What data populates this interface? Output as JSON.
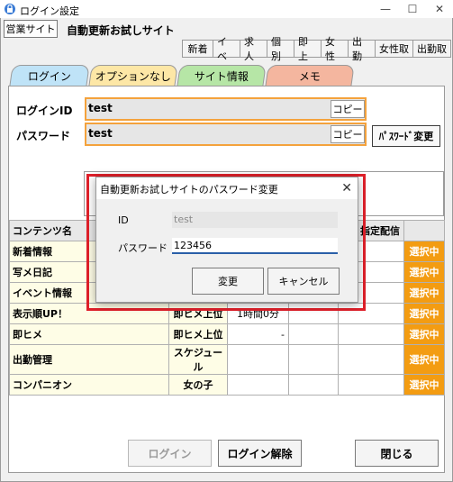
{
  "window": {
    "title": "ログイン設定",
    "minimize": "—",
    "maximize": "☐",
    "close": "✕"
  },
  "header": {
    "site_button": "営業サイト",
    "site_name": "自動更新お試しサイト"
  },
  "categories": [
    "新着",
    "イベ",
    "求人",
    "個別",
    "即上",
    "女性",
    "出勤",
    "女性取",
    "出勤取"
  ],
  "tabs": {
    "login": "ログイン",
    "options": "オプションなし",
    "site_info": "サイト情報",
    "memo": "メモ"
  },
  "login": {
    "id_label": "ログインID",
    "id_value": "test",
    "password_label": "パスワード",
    "password_value": "test",
    "copy_label": "コピー",
    "password_change_label": "ﾊﾟｽﾜｰﾄﾞ変更"
  },
  "table": {
    "header": {
      "name": "コンテンツ名",
      "schedule": "指定配信"
    },
    "rows": [
      {
        "name": "新着情報",
        "page": "",
        "interval": "",
        "extra": "",
        "schedule": "",
        "status": "選択中"
      },
      {
        "name": "写メ日記",
        "page": "",
        "interval": "",
        "extra": "",
        "schedule": "",
        "status": "選択中"
      },
      {
        "name": "イベント情報",
        "page": "",
        "interval": "",
        "extra": "",
        "schedule": "",
        "status": "選択中"
      },
      {
        "name": "表示順UP！",
        "page": "即ヒメ上位",
        "interval": "1時間0分",
        "extra": "",
        "schedule": "",
        "status": "選択中"
      },
      {
        "name": "即ヒメ",
        "page": "即ヒメ上位",
        "interval": "-",
        "extra": "",
        "schedule": "",
        "status": "選択中"
      },
      {
        "name": "出勤管理",
        "page": "スケジュール",
        "interval": "",
        "extra": "",
        "schedule": "",
        "status": "選択中"
      },
      {
        "name": "コンパニオン",
        "page": "女の子",
        "interval": "",
        "extra": "",
        "schedule": "",
        "status": "選択中"
      }
    ]
  },
  "footer": {
    "login": "ログイン",
    "logout": "ログイン解除",
    "close": "閉じる"
  },
  "dialog": {
    "title": "自動更新お試しサイトのパスワード変更",
    "close": "✕",
    "id_label": "ID",
    "id_value": "test",
    "password_label": "パスワード",
    "password_value": "123456",
    "change_button": "変更",
    "cancel_button": "キャンセル"
  },
  "colors": {
    "tab_login": "#bfe3f7",
    "tab_options": "#fde7a6",
    "tab_site_info": "#b6e6a6",
    "tab_memo": "#f4b69f",
    "status": "#f39c12",
    "field_border": "#f4a23c",
    "highlight": "#e0202a"
  }
}
